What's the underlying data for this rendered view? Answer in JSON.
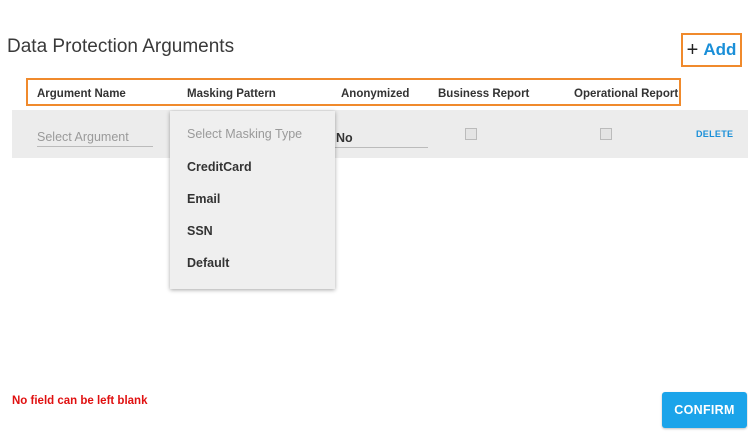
{
  "page": {
    "title": "Data Protection Arguments"
  },
  "toolbar": {
    "add_icon": "plus-icon",
    "add_label": "Add"
  },
  "table": {
    "columns": [
      "Argument Name",
      "Masking Pattern",
      "Anonymized",
      "Business Report",
      "Operational Report"
    ],
    "rows": [
      {
        "argument_placeholder": "Select Argument",
        "anonymized_value": "No",
        "business_report_checked": false,
        "operational_report_checked": false,
        "delete_label": "DELETE"
      }
    ]
  },
  "masking_dropdown": {
    "placeholder": "Select Masking Type",
    "options": [
      "CreditCard",
      "Email",
      "SSN",
      "Default"
    ]
  },
  "validation": {
    "error": "No field can be left blank"
  },
  "footer": {
    "confirm_label": "CONFIRM"
  },
  "colors": {
    "accent": "#1a8fd8",
    "highlight": "#f08a2c",
    "error": "#e01010",
    "button": "#1ba4ea"
  }
}
